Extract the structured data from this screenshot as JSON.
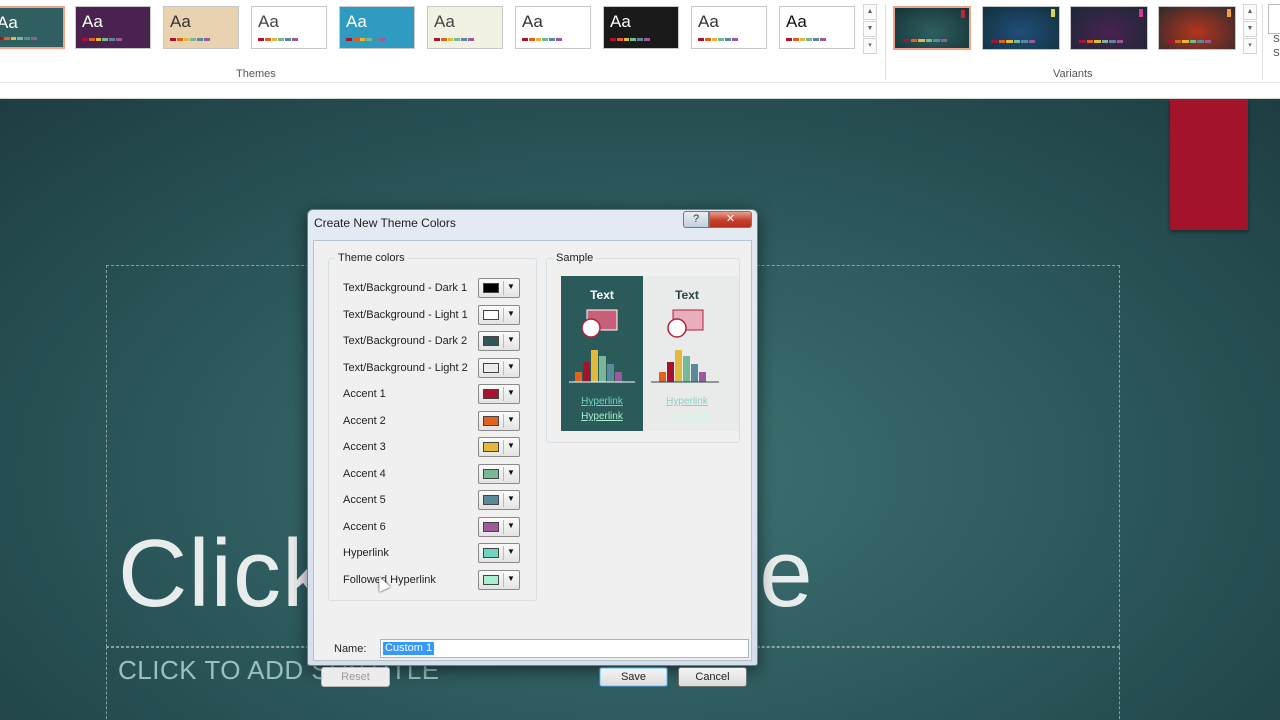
{
  "ribbon": {
    "themes_label": "Themes",
    "variants_label": "Variants",
    "theme_thumbs": [
      {
        "aa": "Aa",
        "bg": "#2f5f60",
        "fg": "#ffffff",
        "sel": true
      },
      {
        "aa": "Aa",
        "bg": "#4a2250",
        "fg": "#ffffff",
        "sel": false
      },
      {
        "aa": "Aa",
        "bg": "#e9d2b0",
        "fg": "#333333",
        "sel": false
      },
      {
        "aa": "Aa",
        "bg": "#ffffff",
        "fg": "#444444",
        "sel": false
      },
      {
        "aa": "Aa",
        "bg": "#2f9bc1",
        "fg": "#ffffff",
        "sel": false
      },
      {
        "aa": "Aa",
        "bg": "#f1f2e4",
        "fg": "#444444",
        "sel": false
      },
      {
        "aa": "Aa",
        "bg": "#ffffff",
        "fg": "#333333",
        "sel": false
      },
      {
        "aa": "Aa",
        "bg": "#1a1a1a",
        "fg": "#ffffff",
        "sel": false
      },
      {
        "aa": "Aa",
        "bg": "#ffffff",
        "fg": "#333333",
        "sel": false
      },
      {
        "aa": "Aa",
        "bg": "#ffffff",
        "fg": "#111111",
        "sel": false
      }
    ],
    "variants": [
      {
        "bg": "#2f5f60",
        "tag": "#c0263a",
        "sel": true
      },
      {
        "bg": "#1f4e7a",
        "tag": "#d8d83a",
        "sel": false
      },
      {
        "bg": "#4a2250",
        "tag": "#d13a8c",
        "sel": false
      },
      {
        "bg": "#b5341e",
        "tag": "#f0a030",
        "sel": false
      }
    ],
    "side_letters": [
      "S",
      "S"
    ]
  },
  "slide": {
    "title": "Click to add title",
    "subtitle": "CLICK TO ADD SUBTITLE"
  },
  "dialog": {
    "title": "Create New Theme Colors",
    "help": "?",
    "close": "✕",
    "theme_colors_legend": "Theme colors",
    "sample_legend": "Sample",
    "rows": [
      {
        "label": "Text/Background - Dark 1",
        "color": "#000000"
      },
      {
        "label": "Text/Background - Light 1",
        "color": "#ffffff"
      },
      {
        "label": "Text/Background - Dark 2",
        "color": "#2f5857"
      },
      {
        "label": "Text/Background - Light 2",
        "color": "#ececec"
      },
      {
        "label": "Accent 1",
        "color": "#a5142c"
      },
      {
        "label": "Accent 2",
        "color": "#e0621c"
      },
      {
        "label": "Accent 3",
        "color": "#e2b93b"
      },
      {
        "label": "Accent 4",
        "color": "#77b896"
      },
      {
        "label": "Accent 5",
        "color": "#5a8a98"
      },
      {
        "label": "Accent 6",
        "color": "#9b5a9a"
      },
      {
        "label": "Hyperlink",
        "color": "#6fd4c0"
      },
      {
        "label": "Followed Hyperlink",
        "color": "#a8f0d0"
      }
    ],
    "sample": {
      "text_dark": "Text",
      "text_light": "Text",
      "hyperlink": "Hyperlink",
      "followed": "Hyperlink"
    },
    "name_label": "Name:",
    "name_value": "Custom 1",
    "reset": "Reset",
    "save": "Save",
    "cancel": "Cancel"
  }
}
